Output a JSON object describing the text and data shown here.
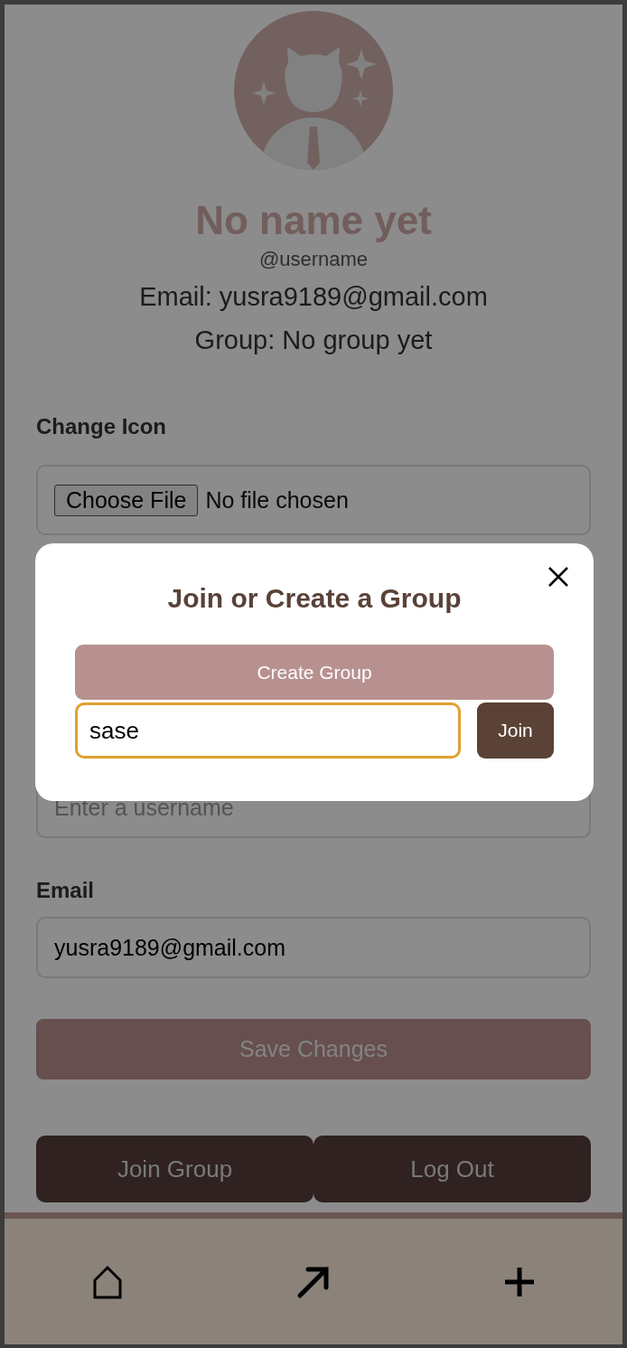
{
  "profile": {
    "name": "No name yet",
    "handle": "@username",
    "email_line": "Email: yusra9189@gmail.com",
    "group_line": "Group: No group yet"
  },
  "icon_section": {
    "label": "Change Icon",
    "button": "Choose File",
    "status": "No file chosen"
  },
  "username_field": {
    "placeholder": "Enter a username"
  },
  "email_section": {
    "label": "Email",
    "value": "yusra9189@gmail.com"
  },
  "save_button": "Save Changes",
  "actions": [
    "Join Group",
    "Log Out"
  ],
  "nav": [
    {
      "kind": "home"
    },
    {
      "kind": "arrow"
    },
    {
      "kind": "plus"
    }
  ],
  "modal": {
    "title": "Join or Create a Group",
    "create_button": "Create Group",
    "code_value": "sase",
    "join_button": "Join"
  }
}
